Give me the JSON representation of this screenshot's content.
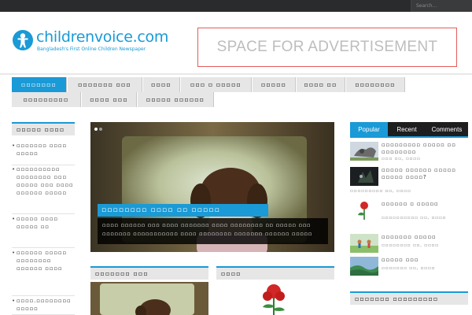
{
  "topbar": {
    "search_placeholder": "Search..."
  },
  "brand": {
    "name": "childrenvoice.com",
    "tagline": "Bangladesh's First Online Children Newspaper",
    "accent": "#1a9ad6"
  },
  "ad": {
    "text": "SPACE FOR ADVERTISEMENT"
  },
  "nav": {
    "items": [
      {
        "label": "▫▫▫▫▫▫▫"
      },
      {
        "label": "▫▫▫▫▫▫▫ ▫▫▫"
      },
      {
        "label": "▫▫▫▫"
      },
      {
        "label": "▫▫▫ ▫ ▫▫▫▫▫"
      },
      {
        "label": "▫▫▫▫▫"
      },
      {
        "label": "▫▫▫▫ ▫▫"
      },
      {
        "label": "▫▫▫▫▫▫▫▫"
      },
      {
        "label": "▫▫▫▫▫▫▫▫▫"
      },
      {
        "label": "▫▫▫▫ ▫▫▫"
      },
      {
        "label": "▫▫▫▫▫ ▫▫▫▫▫▫"
      }
    ]
  },
  "left": {
    "heading": "▫▫▫▫▫ ▫▫▫▫",
    "items": [
      {
        "text": "▫▫▫▫▫▫▫ ▫▫▫▫ ▫▫▫▫▫"
      },
      {
        "text": "▫▫▫▫▫▫▫▫▫▫ ▫▫▫▫▫▫▫▫ ▫▫▫ ▫▫▫▫▫ ▫▫▫ ▫▫▫▫ ▫▫▫▫▫▫ ▫▫▫▫▫"
      },
      {
        "text": "▫▫▫▫▫ ▫▫▫▫ ▫▫▫▫▫ ▫▫"
      },
      {
        "text": "▫▫▫▫▫▫ ▫▫▫▫▫ ▫▫▫▫▫▫▫▫ ▫▫▫▫▫▫ ▫▫▫▫"
      },
      {
        "text": "▫▫▫▫.▫▫▫▫▫▫▫▫ ▫▫▫▫▫"
      }
    ]
  },
  "slider": {
    "title": "▫▫▫▫▫▫▫▫ ▫▫▫▫ ▫▫ ▫▫▫▫▫",
    "caption": "▫▫▫▫ ▫▫▫▫▫▫ ▫▫▫ ▫▫▫▫ ▫▫▫▫▫▫▫ ▫▫▫▫ ▫▫▫▫▫▫▫▫ ▫▫ ▫▫▫▫▫ ▫▫▫ ▫▫▫▫▫▫▫ ▫▫▫▫▫▫▫▫▫▫▫ ▫▫▫▫ ▫▫▫▫▫▫▫▫ ▫▫▫▫▫▫▫ ▫▫▫▫▫▫ ▫▫▫▫▫"
  },
  "sections": {
    "middle_left": "▫▫▫▫▫▫▫ ▫▫▫",
    "middle_right": "▫▫▫▫",
    "right_bottom": "▫▫▫▫▫▫▫ ▫▫▫▫▫▫▫▫▫"
  },
  "tabs": {
    "items": [
      {
        "label": "Popular"
      },
      {
        "label": "Recent"
      },
      {
        "label": "Comments"
      }
    ]
  },
  "popular": [
    {
      "title": "▫▫▫▫▫▫▫▫▫ ▫▫▫▫▫ ▫▫ ▫▫▫▫▫▫▫▫",
      "date": "▫▫▫ ▫▫, ▫▫▫▫"
    },
    {
      "title": "▫▫▫▫▫ ▫▫▫▫▫▫ ▫▫▫▫▫ ▫▫▫▫▫ ▫▫▫▫?",
      "date": "▫▫▫▫▫▫▫▫▫ ▫▫, ▫▫▫▫"
    },
    {
      "title": "▫▫▫▫▫▫ ▫ ▫▫▫▫▫",
      "date": "▫▫▫▫▫▫▫▫▫▫ ▫▫, ▫▫▫▫"
    },
    {
      "title": "▫▫▫▫▫▫▫ ▫▫▫▫▫",
      "date": "▫▫▫▫▫▫▫▫ ▫▫, ▫▫▫▫"
    },
    {
      "title": "▫▫▫▫▫ ▫▫▫",
      "date": "▫▫▫▫▫▫▫ ▫▫, ▫▫▫▫"
    }
  ]
}
